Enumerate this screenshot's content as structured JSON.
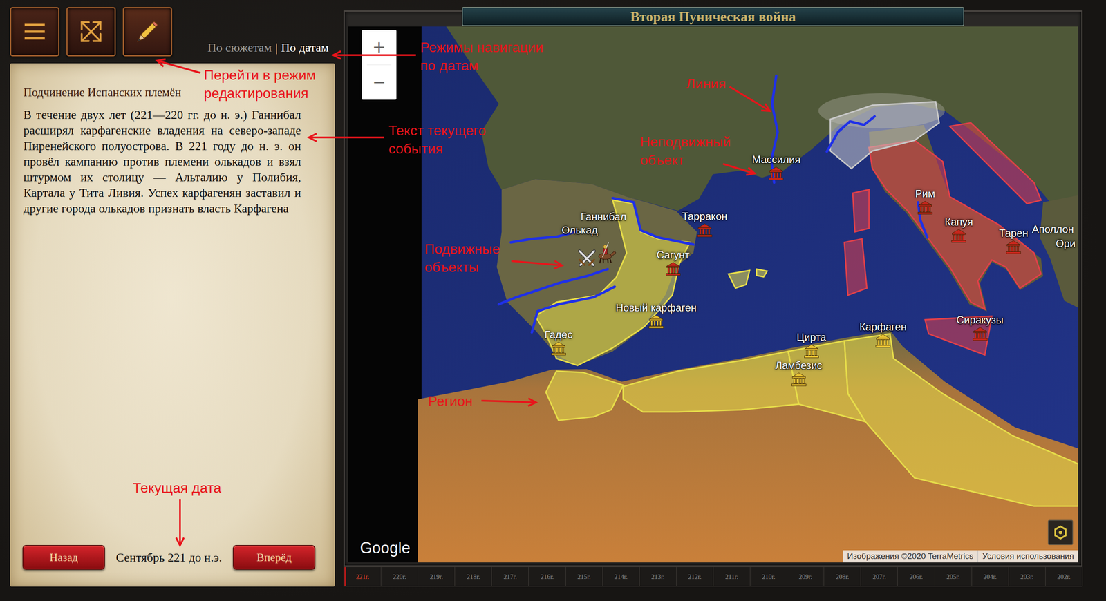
{
  "nav_modes": {
    "items": [
      {
        "label": "По сюжетам",
        "selected": false
      },
      {
        "label": "По датам",
        "selected": true
      }
    ],
    "separator": "|"
  },
  "event": {
    "title": "Подчинение Испанских племён",
    "text": "В течение двух лет (221—220 гг. до н. э.) Ганнибал расширял карфагенские владения на северо-западе Пиренейского полуострова. В 221 году до н. э. он провёл кампанию против племени олькадов и взял штурмом их столицу — Альталию у Полибия, Картала у Тита Ливия. Успех карфагенян заставил и другие города олькадов признать власть Карфагена"
  },
  "navigation": {
    "back": "Назад",
    "date": "Сентябрь 221 до н.э.",
    "forward": "Вперёд"
  },
  "map": {
    "title": "Вторая Пуническая война",
    "zoom": {
      "in": "+",
      "out": "−"
    },
    "logo": "Google",
    "attribution": [
      "Изображения ©2020 TerraMetrics",
      "Условия использования"
    ],
    "regions": [
      {
        "color": "#e6dc4a"
      },
      {
        "color": "#e6dc4a"
      },
      {
        "color": "#e6dc4a"
      },
      {
        "color": "#e6dc4a"
      },
      {
        "color": "#e6dc4a"
      },
      {
        "color": "#e6dc4a"
      },
      {
        "color": "#e6dc4a"
      },
      {
        "color": "#e0404a"
      },
      {
        "color": "#e0404a"
      },
      {
        "color": "#e0404a"
      },
      {
        "color": "#e0404a"
      },
      {
        "color": "#e0404a"
      },
      {
        "color": "#c8c8c8"
      }
    ],
    "cities": [
      {
        "label": "Массилия",
        "kind": "city",
        "color": "#c8261c"
      },
      {
        "label": "Рим",
        "kind": "city",
        "color": "#c8261c"
      },
      {
        "label": "Капуя",
        "kind": "city",
        "color": "#c8261c"
      },
      {
        "label": "Тарен",
        "kind": "city",
        "color": "#c8261c"
      },
      {
        "label": "Аполлон",
        "kind": "edge"
      },
      {
        "label": "Ори",
        "kind": "edge"
      },
      {
        "label": "Тарракон",
        "kind": "city",
        "color": "#c8261c"
      },
      {
        "label": "Сагунт",
        "kind": "city",
        "color": "#c8261c"
      },
      {
        "label": "Новый карфаген",
        "kind": "city",
        "color": "#e8c233"
      },
      {
        "label": "Гадес",
        "kind": "city",
        "color": "#e8c233"
      },
      {
        "label": "Цирта",
        "kind": "city",
        "color": "#e8c233"
      },
      {
        "label": "Ламбезис",
        "kind": "city",
        "color": "#e8c233"
      },
      {
        "label": "Карфаген",
        "kind": "city",
        "color": "#e8c233"
      },
      {
        "label": "Сиракузы",
        "kind": "city",
        "color": "#c8261c"
      }
    ],
    "units": [
      {
        "label": "Ганнибал",
        "kind": "cavalry"
      },
      {
        "label": "Олькад",
        "kind": "battle"
      }
    ]
  },
  "timeline": [
    {
      "label": "221г.",
      "selected": true
    },
    {
      "label": "220г.",
      "selected": false
    },
    {
      "label": "219г.",
      "selected": false
    },
    {
      "label": "218г.",
      "selected": false
    },
    {
      "label": "217г.",
      "selected": false
    },
    {
      "label": "216г.",
      "selected": false
    },
    {
      "label": "215г.",
      "selected": false
    },
    {
      "label": "214г.",
      "selected": false
    },
    {
      "label": "213г.",
      "selected": false
    },
    {
      "label": "212г.",
      "selected": false
    },
    {
      "label": "211г.",
      "selected": false
    },
    {
      "label": "210г.",
      "selected": false
    },
    {
      "label": "209г.",
      "selected": false
    },
    {
      "label": "208г.",
      "selected": false
    },
    {
      "label": "207г.",
      "selected": false
    },
    {
      "label": "206г.",
      "selected": false
    },
    {
      "label": "205г.",
      "selected": false
    },
    {
      "label": "204г.",
      "selected": false
    },
    {
      "label": "203г.",
      "selected": false
    },
    {
      "label": "202г.",
      "selected": false
    }
  ],
  "annotations": [
    {
      "lines": [
        "Режимы навигации",
        "по датам"
      ]
    },
    {
      "lines": [
        "Перейти в режим",
        "редактирования"
      ]
    },
    {
      "lines": [
        "Текст текущего",
        "события"
      ]
    },
    {
      "lines": [
        "Линия"
      ]
    },
    {
      "lines": [
        "Неподвижный",
        "объект"
      ]
    },
    {
      "lines": [
        "Подвижные",
        "объекты"
      ]
    },
    {
      "lines": [
        "Регион"
      ]
    },
    {
      "lines": [
        "Текущая дата"
      ]
    }
  ]
}
